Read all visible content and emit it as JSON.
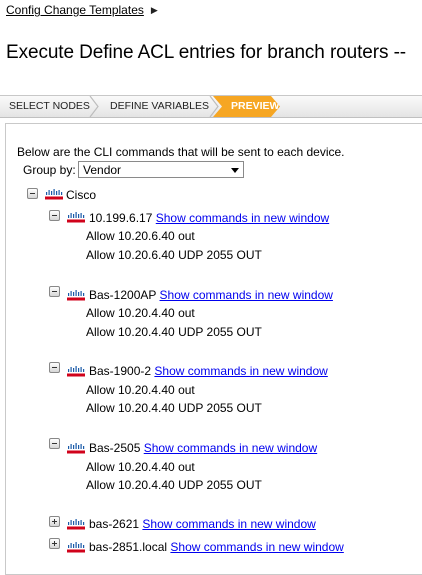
{
  "breadcrumb": {
    "label": "Config Change Templates"
  },
  "page_title": "Execute Define ACL entries for branch routers --",
  "wizard": {
    "steps": [
      {
        "label": "SELECT NODES"
      },
      {
        "label": "DEFINE VARIABLES"
      },
      {
        "label": "PREVIEW",
        "active": true
      }
    ],
    "accent_color": "#f6a623"
  },
  "intro_text": "Below are the CLI commands that will be sent to each device.",
  "group_by": {
    "label": "Group by:",
    "value": "Vendor"
  },
  "tree": {
    "root_label": "Cisco",
    "link_text": "Show commands in new window",
    "nodes": [
      {
        "name": "10.199.6.17",
        "commands": [
          "Allow 10.20.6.40 out",
          "Allow 10.20.6.40 UDP 2055 OUT"
        ],
        "expanded": true
      },
      {
        "name": "Bas-1200AP",
        "commands": [
          "Allow 10.20.4.40 out",
          "Allow 10.20.4.40 UDP 2055 OUT"
        ],
        "expanded": true
      },
      {
        "name": "Bas-1900-2",
        "commands": [
          "Allow 10.20.4.40 out",
          "Allow 10.20.4.40 UDP 2055 OUT"
        ],
        "expanded": true
      },
      {
        "name": "Bas-2505",
        "commands": [
          "Allow 10.20.4.40 out",
          "Allow 10.20.4.40 UDP 2055 OUT"
        ],
        "expanded": true
      },
      {
        "name": "bas-2621",
        "commands": [],
        "expanded": false
      },
      {
        "name": "bas-2851.local",
        "commands": [],
        "expanded": false
      }
    ]
  }
}
